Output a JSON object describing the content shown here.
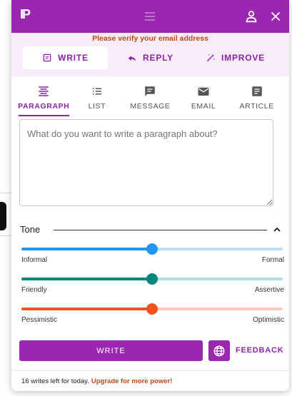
{
  "app": {
    "logo": "IP"
  },
  "banner": {
    "text": "Please verify your email address"
  },
  "modes": [
    {
      "label": "WRITE",
      "icon": "edit-icon",
      "active": true
    },
    {
      "label": "REPLY",
      "icon": "reply-icon",
      "active": false
    },
    {
      "label": "IMPROVE",
      "icon": "magic-wand-icon",
      "active": false
    }
  ],
  "types": [
    {
      "label": "PARAGRAPH",
      "icon": "paragraph-icon",
      "active": true
    },
    {
      "label": "LIST",
      "icon": "list-icon",
      "active": false
    },
    {
      "label": "MESSAGE",
      "icon": "message-icon",
      "active": false
    },
    {
      "label": "EMAIL",
      "icon": "email-icon",
      "active": false
    },
    {
      "label": "ARTICLE",
      "icon": "article-icon",
      "active": false
    }
  ],
  "input": {
    "placeholder": "What do you want to write a paragraph about?",
    "value": ""
  },
  "tone": {
    "label": "Tone",
    "sliders": [
      {
        "left": "Informal",
        "right": "Formal",
        "level": 0.5,
        "color": "#2196f3",
        "track": "#bbdefb"
      },
      {
        "left": "Friendly",
        "right": "Assertive",
        "level": 0.5,
        "color": "#00897b",
        "track": "#b2dfdb"
      },
      {
        "left": "Pessimistic",
        "right": "Optimistic",
        "level": 0.5,
        "color": "#f4511e",
        "track": "#ffccbc"
      }
    ]
  },
  "actions": {
    "write": "WRITE",
    "feedback": "FEEDBACK"
  },
  "footer": {
    "text": "16 writes left for today.",
    "upgrade": "Upgrade for more power!"
  },
  "colors": {
    "brand": "#9b27b0",
    "accent": "#8e24aa",
    "warning": "#c0471a"
  }
}
